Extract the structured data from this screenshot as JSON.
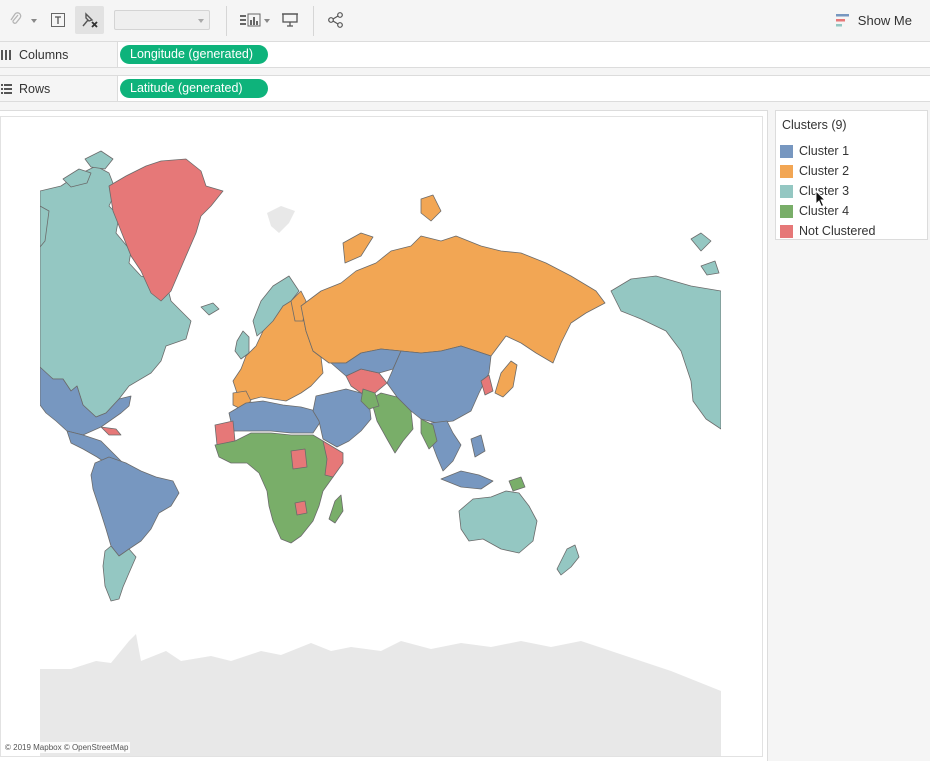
{
  "toolbar": {
    "icons": [
      "paperclip-icon",
      "text-icon",
      "clear-pin-icon",
      "show-cards-icon",
      "presentation-icon",
      "share-icon"
    ],
    "show_me_label": "Show Me"
  },
  "shelves": {
    "columns": {
      "label": "Columns",
      "pill": "Longitude (generated)"
    },
    "rows": {
      "label": "Rows",
      "pill": "Latitude (generated)"
    }
  },
  "legend": {
    "title": "Clusters (9)",
    "items": [
      {
        "label": "Cluster 1",
        "color": "#7797c0"
      },
      {
        "label": "Cluster 2",
        "color": "#f2a654"
      },
      {
        "label": "Cluster 3",
        "color": "#94c7c2"
      },
      {
        "label": "Cluster 4",
        "color": "#79ae69"
      },
      {
        "label": "Not Clustered",
        "color": "#e67878"
      }
    ]
  },
  "map": {
    "attribution": "© 2019 Mapbox © OpenStreetMap",
    "land_color": "#e8e8e8",
    "border_color": "#6b6b6b"
  }
}
